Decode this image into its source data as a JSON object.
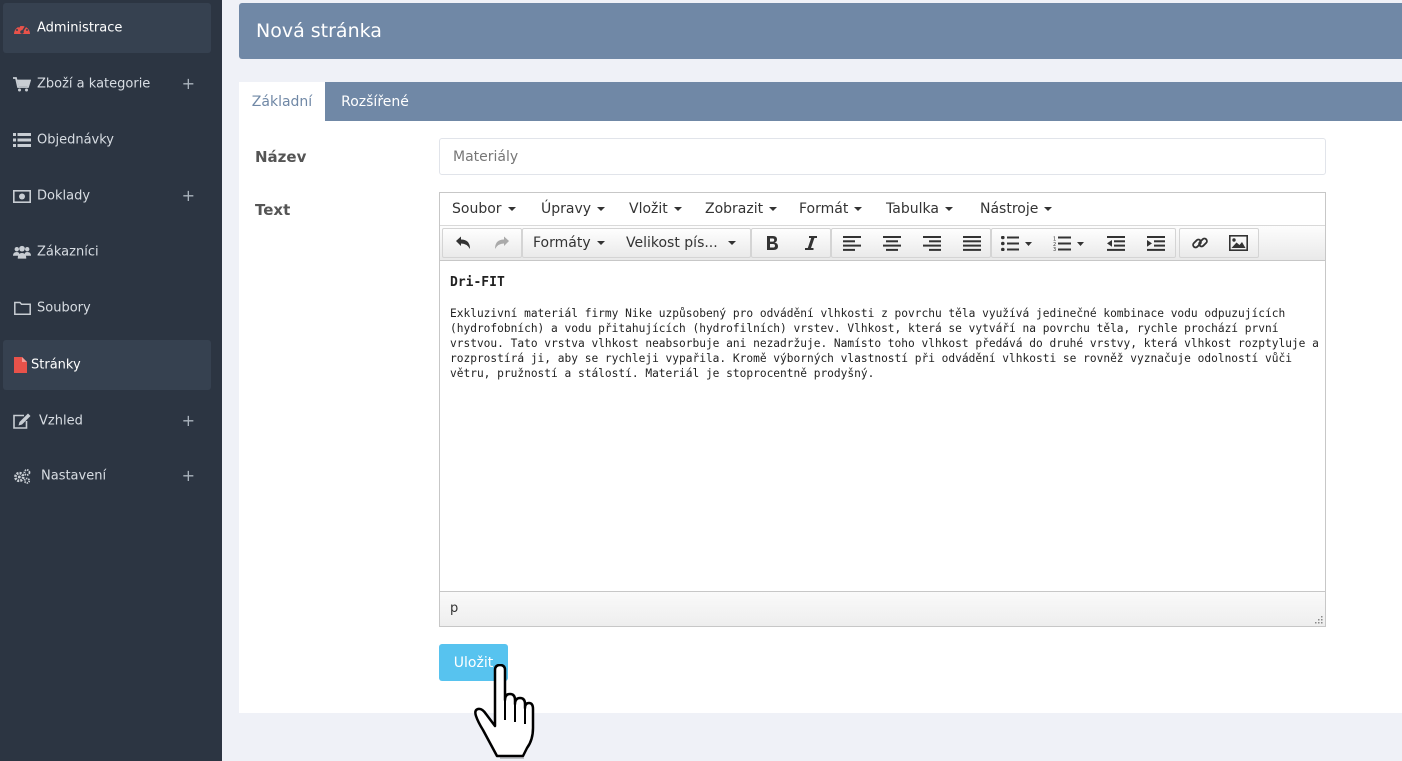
{
  "sidebar": {
    "items": [
      {
        "label": "Administrace",
        "icon": "dashboard-icon",
        "plus": ""
      },
      {
        "label": "Zboží a kategorie",
        "icon": "cart-icon",
        "plus": "+"
      },
      {
        "label": "Objednávky",
        "icon": "list-icon",
        "plus": ""
      },
      {
        "label": "Doklady",
        "icon": "money-icon",
        "plus": "+"
      },
      {
        "label": "Zákazníci",
        "icon": "users-icon",
        "plus": ""
      },
      {
        "label": "Soubory",
        "icon": "folder-icon",
        "plus": ""
      },
      {
        "label": "Stránky",
        "icon": "file-icon",
        "plus": ""
      },
      {
        "label": "Vzhled",
        "icon": "edit-icon",
        "plus": "+"
      },
      {
        "label": "Nastavení",
        "icon": "gears-icon",
        "plus": "+"
      }
    ],
    "accent_color": "#e8524a"
  },
  "header": {
    "title": "Nová stránka"
  },
  "tabs": [
    {
      "label": "Základní"
    },
    {
      "label": "Rozšířené"
    }
  ],
  "form": {
    "name_label": "Název",
    "name_value": "Materiály",
    "text_label": "Text"
  },
  "editor": {
    "menu": [
      "Soubor",
      "Úpravy",
      "Vložit",
      "Zobrazit",
      "Formát",
      "Tabulka",
      "Nástroje"
    ],
    "formats_label": "Formáty",
    "font_size_label": "Velikost pís...",
    "content_title": "Dri-FIT",
    "content_text": "Exkluzivní materiál firmy Nike uzpůsobený pro odvádění vlhkosti z povrchu těla využívá jedinečné kombinace vodu odpuzujících (hydrofobních) a vodu přitahujících (hydrofilních) vrstev. Vlhkost, která se vytváří na povrchu těla, rychle prochází první vrstvou. Tato vrstva vlhkost neabsorbuje ani nezadržuje. Namísto toho vlhkost předává do druhé vrstvy, která vlhkost rozptyluje a rozprostírá ji, aby se rychleji vypařila. Kromě výborných vlastností při odvádění vlhkosti se rovněž vyznačuje odolností vůči větru, pružností a stálostí. Materiál je stoprocentně prodyšný.",
    "status_path": "p"
  },
  "save_label": "Uložit",
  "colors": {
    "sidebar_bg": "#2c3542",
    "header_bg": "#7088a6",
    "save_button": "#57c3ef"
  }
}
